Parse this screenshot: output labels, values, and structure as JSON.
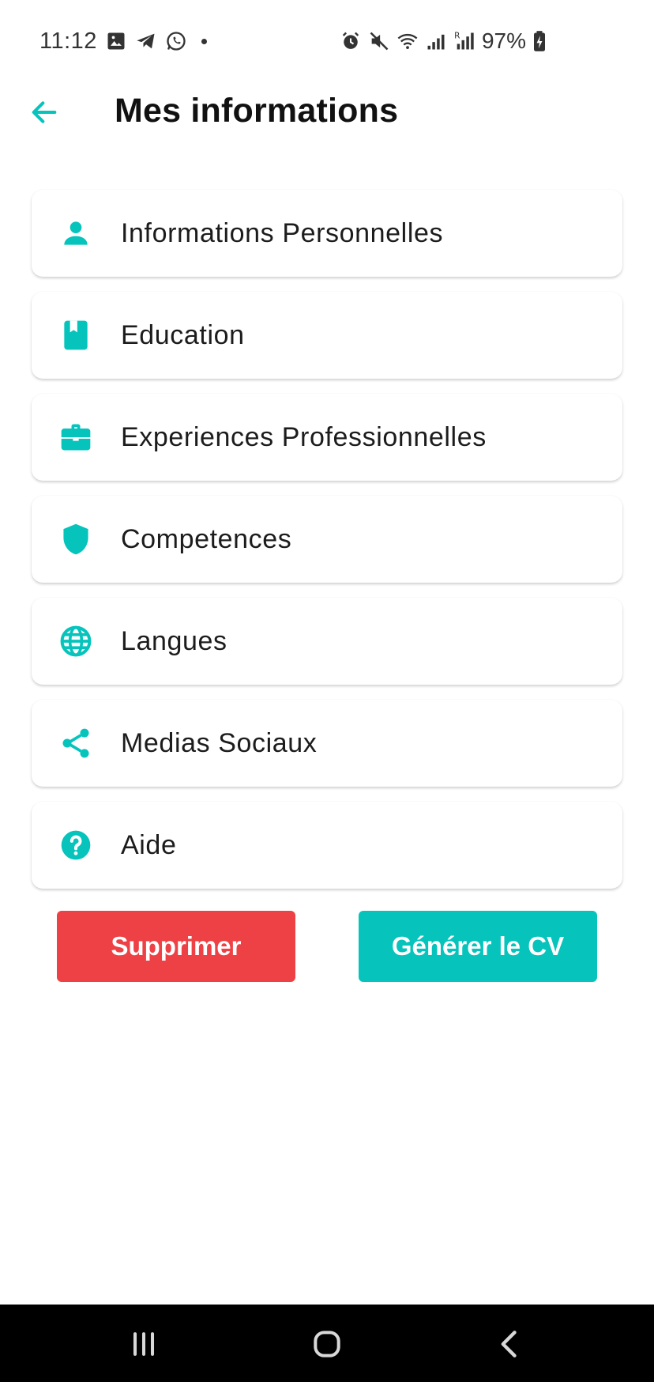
{
  "status_bar": {
    "time": "11:12",
    "battery_text": "97%",
    "left_icons": [
      "gallery-icon",
      "telegram-icon",
      "whatsapp-icon",
      "notification-dot"
    ],
    "right_icons": [
      "alarm-icon",
      "mute-icon",
      "wifi-icon",
      "signal-icon",
      "signal-roaming-icon",
      "battery-charging-icon"
    ]
  },
  "app_bar": {
    "title": "Mes informations",
    "back_icon": "arrow-back-icon"
  },
  "menu": {
    "items": [
      {
        "label": "Informations Personnelles",
        "icon": "person-icon"
      },
      {
        "label": "Education",
        "icon": "book-icon"
      },
      {
        "label": "Experiences Professionnelles",
        "icon": "briefcase-icon"
      },
      {
        "label": "Competences",
        "icon": "shield-icon"
      },
      {
        "label": "Langues",
        "icon": "globe-icon"
      },
      {
        "label": "Medias Sociaux",
        "icon": "share-icon"
      },
      {
        "label": "Aide",
        "icon": "help-icon"
      }
    ]
  },
  "actions": {
    "delete_label": "Supprimer",
    "generate_label": "Générer le CV"
  },
  "colors": {
    "accent": "#06c4bc",
    "danger": "#ee4145",
    "nav_background": "#000000"
  },
  "nav_bar": {
    "icons": [
      "recent-apps-icon",
      "home-icon",
      "nav-back-icon"
    ]
  }
}
